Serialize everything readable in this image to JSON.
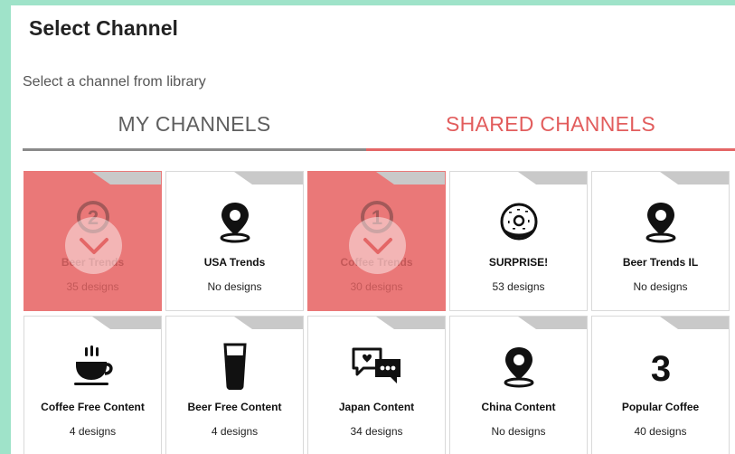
{
  "header": {
    "title": "Select Channel",
    "subtitle": "Select a channel from library"
  },
  "tabs": [
    {
      "label": "MY CHANNELS",
      "active": false
    },
    {
      "label": "SHARED CHANNELS",
      "active": true
    }
  ],
  "colors": {
    "background": "#9fe3c9",
    "accent": "#e25d5d",
    "selected_card": "#ea7878"
  },
  "channels": [
    {
      "name": "Beer Trends",
      "count": "35 designs",
      "icon": "badge-number-2-icon",
      "selected": true
    },
    {
      "name": "USA Trends",
      "count": "No designs",
      "icon": "map-pin-icon",
      "selected": false
    },
    {
      "name": "Coffee Trends",
      "count": "30 designs",
      "icon": "badge-number-1-icon",
      "selected": true
    },
    {
      "name": "SURPRISE!",
      "count": "53 designs",
      "icon": "donut-icon",
      "selected": false
    },
    {
      "name": "Beer Trends IL",
      "count": "No designs",
      "icon": "map-pin-icon",
      "selected": false
    },
    {
      "name": "Coffee Free Content",
      "count": "4 designs",
      "icon": "coffee-cup-icon",
      "selected": false
    },
    {
      "name": "Beer Free Content",
      "count": "4 designs",
      "icon": "beer-glass-icon",
      "selected": false
    },
    {
      "name": "Japan Content",
      "count": "34 designs",
      "icon": "chat-bubbles-icon",
      "selected": false
    },
    {
      "name": "China Content",
      "count": "No designs",
      "icon": "map-pin-icon",
      "selected": false
    },
    {
      "name": "Popular Coffee",
      "count": "40 designs",
      "icon": "number-3-icon",
      "selected": false
    }
  ]
}
